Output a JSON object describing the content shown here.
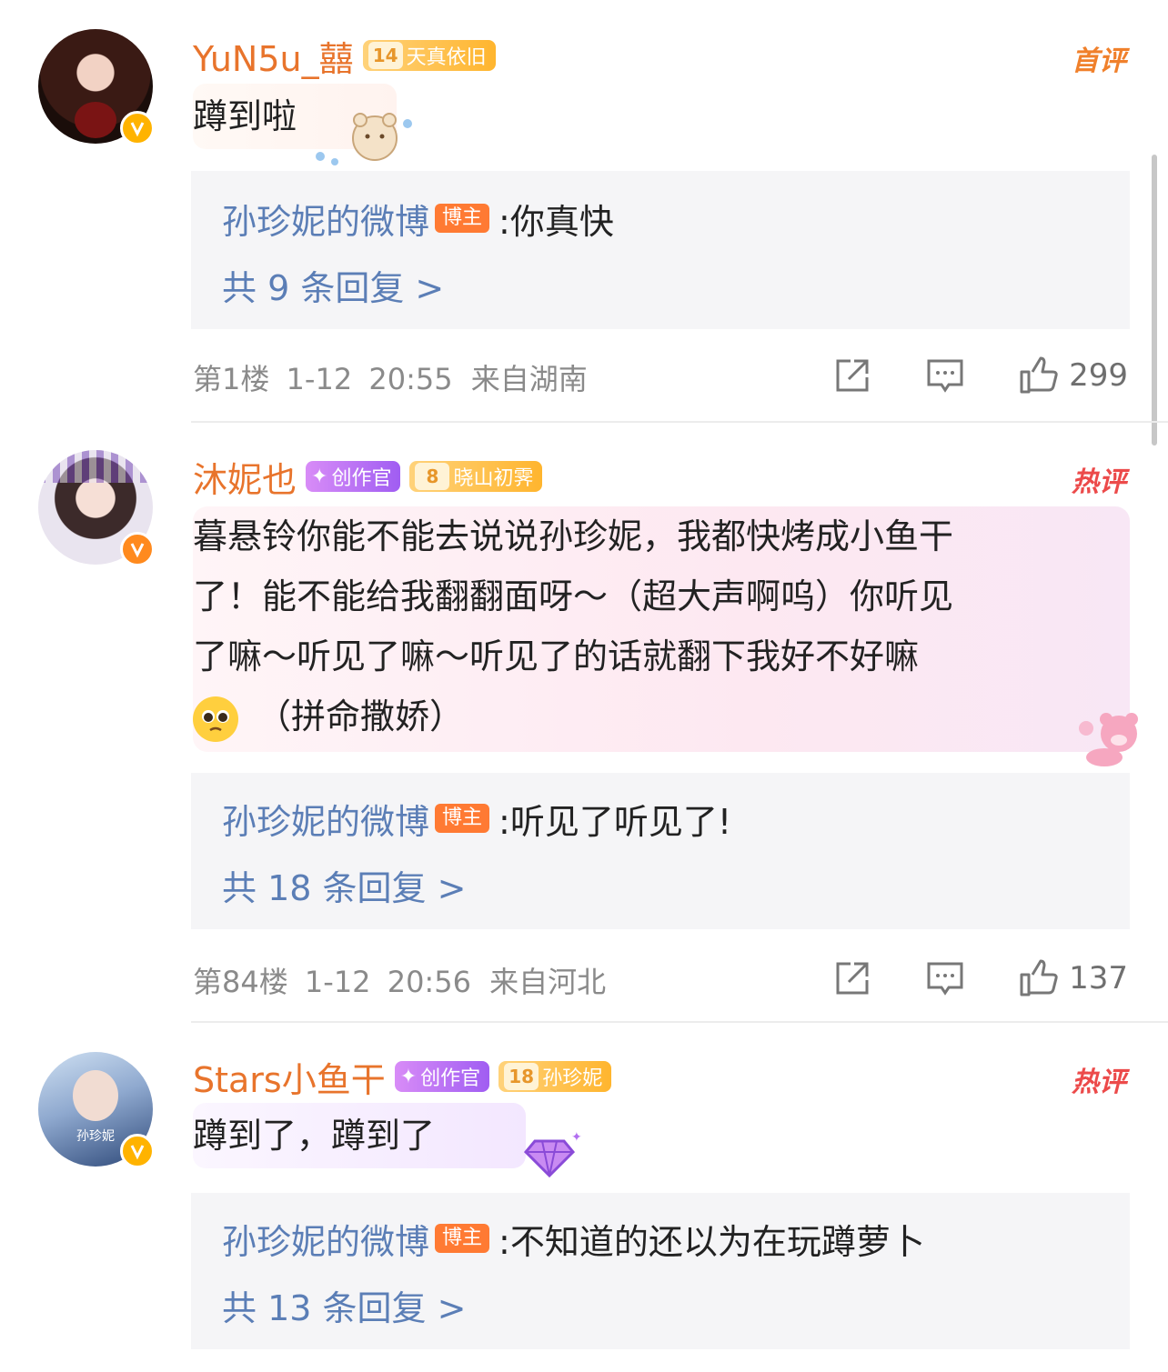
{
  "comments": [
    {
      "username": "YuN5u_囍",
      "fan_level": "14",
      "fan_club": "天真依旧",
      "tag": "首评",
      "text": "蹲到啦",
      "reply_author": "孙珍妮的微博",
      "reply_badge": "博主",
      "reply_text": ":你真快",
      "more_replies": "共 9 条回复 >",
      "floor": "第1楼",
      "date": "1-12",
      "time": "20:55",
      "location": "来自湖南",
      "likes": "299"
    },
    {
      "username": "沐妮也",
      "creator_badge": "创作官",
      "fan_level": "8",
      "fan_club": "晓山初霁",
      "tag": "热评",
      "text_line1": "暮悬铃你能不能去说说孙珍妮，我都快烤成小鱼干",
      "text_line2": "了！能不能给我翻翻面呀～（超大声啊呜）你听见",
      "text_line3": "了嘛～听见了嘛～听见了的话就翻下我好不好嘛",
      "text_line4": "（拼命撒娇）",
      "reply_author": "孙珍妮的微博",
      "reply_badge": "博主",
      "reply_text": ":听见了听见了!",
      "more_replies": "共 18 条回复 >",
      "floor": "第84楼",
      "date": "1-12",
      "time": "20:56",
      "location": "来自河北",
      "likes": "137"
    },
    {
      "username": "Stars小鱼干",
      "creator_badge": "创作官",
      "fan_level": "18",
      "fan_club": "孙珍妮",
      "tag": "热评",
      "text": "蹲到了，蹲到了",
      "reply_author": "孙珍妮的微博",
      "reply_badge": "博主",
      "reply_text": ":不知道的还以为在玩蹲萝卜",
      "more_replies": "共 13 条回复 >"
    }
  ],
  "avatar3_text": "孙珍妮",
  "colors": {
    "username": "#e8742c",
    "link": "#5b7eb6",
    "host_badge": "#ff7a33",
    "hot_tag": "#ec4a4a",
    "first_tag": "#f0802b",
    "verified": "#ffb300"
  }
}
